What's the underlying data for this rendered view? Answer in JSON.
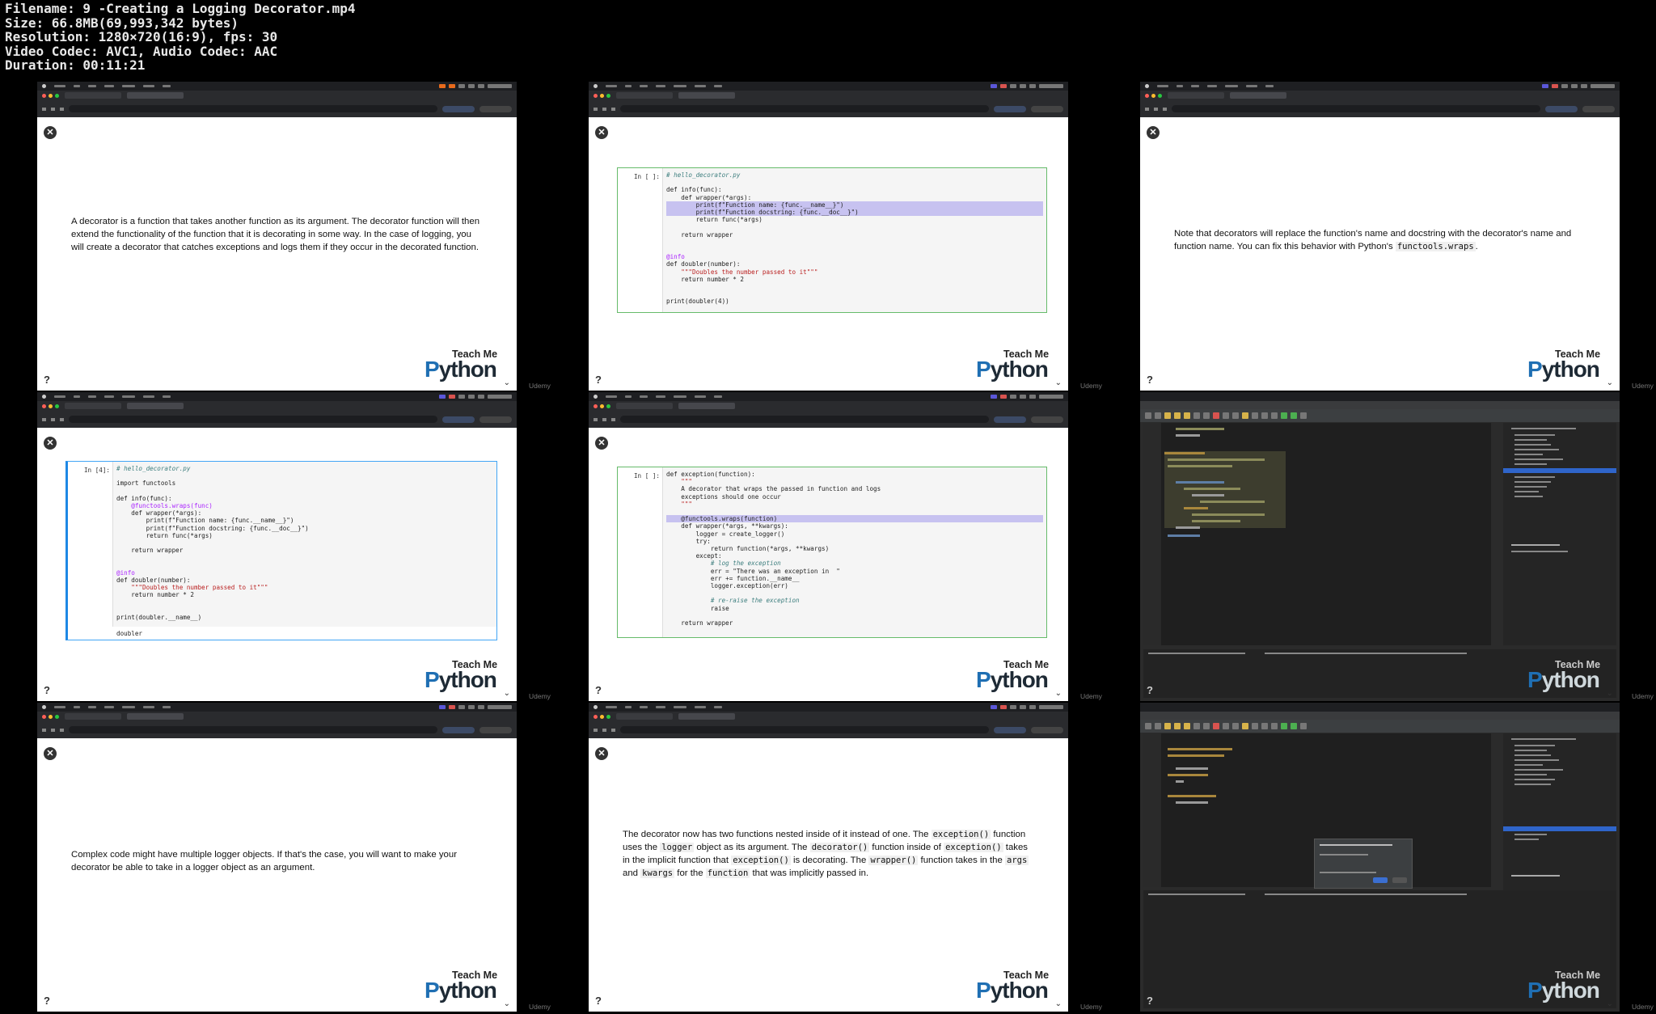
{
  "file_info": {
    "filename": "Filename: 9 -Creating a Logging Decorator.mp4",
    "size": "Size: 66.8MB(69,993,342 bytes)",
    "resolution": "Resolution: 1280×720(16:9), fps: 30",
    "codec": "Video Codec: AVC1, Audio Codec: AAC",
    "duration": "Duration: 00:11:21"
  },
  "logo": {
    "top": "Teach Me",
    "bottom": "Python"
  },
  "watermark": "Udemy",
  "frame1": {
    "text": "A decorator is a function that takes another function as its argument. The decorator function will then extend the functionality of the function that it is decorating in some way. In the case of logging, you will create a decorator that catches exceptions and logs them if they occur in the decorated function."
  },
  "frame2": {
    "prompt": "In [ ]:",
    "code": [
      "# hello_decorator.py",
      "",
      "def info(func):",
      "    def wrapper(*args):",
      "        print(f\"Function name: {func.__name__}\")",
      "        print(f\"Function docstring: {func.__doc__}\")",
      "        return func(*args)",
      "",
      "    return wrapper",
      "",
      "",
      "@info",
      "def doubler(number):",
      "    \"\"\"Doubles the number passed to it\"\"\"",
      "    return number * 2",
      "",
      "",
      "print(doubler(4))"
    ]
  },
  "frame3": {
    "text_before": "Note that decorators will replace the function's name and docstring with the decorator's name and function name. You can fix this behavior with Python's ",
    "code": "functools.wraps",
    "text_after": "."
  },
  "frame4": {
    "prompt": "In [4]:",
    "code": [
      "# hello_decorator.py",
      "",
      "import functools",
      "",
      "def info(func):",
      "    @functools.wraps(func)",
      "    def wrapper(*args):",
      "        print(f\"Function name: {func.__name__}\")",
      "        print(f\"Function docstring: {func.__doc__}\")",
      "        return func(*args)",
      "",
      "    return wrapper",
      "",
      "",
      "@info",
      "def doubler(number):",
      "    \"\"\"Doubles the number passed to it\"\"\"",
      "    return number * 2",
      "",
      "",
      "print(doubler.__name__)"
    ],
    "output": "doubler"
  },
  "frame5": {
    "prompt": "In [ ]:",
    "code": [
      "def exception(function):",
      "    \"\"\"",
      "    A decorator that wraps the passed in function and logs",
      "    exceptions should one occur",
      "    \"\"\"",
      "",
      "    @functools.wraps(function)",
      "    def wrapper(*args, **kwargs):",
      "        logger = create_logger()",
      "        try:",
      "            return function(*args, **kwargs)",
      "        except:",
      "            # log the exception",
      "            err = \"There was an exception in  \"",
      "            err += function.__name__",
      "            logger.exception(err)",
      "",
      "            # re-raise the exception",
      "            raise",
      "",
      "    return wrapper"
    ]
  },
  "frame7": {
    "text": "Complex code might have multiple logger objects. If that's the case, you will want to make your decorator be able to take in a logger object as an argument."
  },
  "frame8": {
    "p1": "The decorator now has two functions nested inside of it instead of one. The ",
    "c1": "exception()",
    "p2": " function uses the ",
    "c2": "logger",
    "p3": " object as its argument. The ",
    "c3": "decorator()",
    "p4": " function inside of ",
    "c4": "exception()",
    "p5": " takes in the implicit function that ",
    "c5": "exception()",
    "p6": " is decorating. The ",
    "c6": "wrapper()",
    "p7": " function takes in the ",
    "c7": "args",
    "p8": " and ",
    "c8": "kwargs",
    "p9": " for the ",
    "c9": "function",
    "p10": " that was implicitly passed in."
  },
  "icons": [
    "close-icon",
    "help-icon",
    "logo"
  ]
}
